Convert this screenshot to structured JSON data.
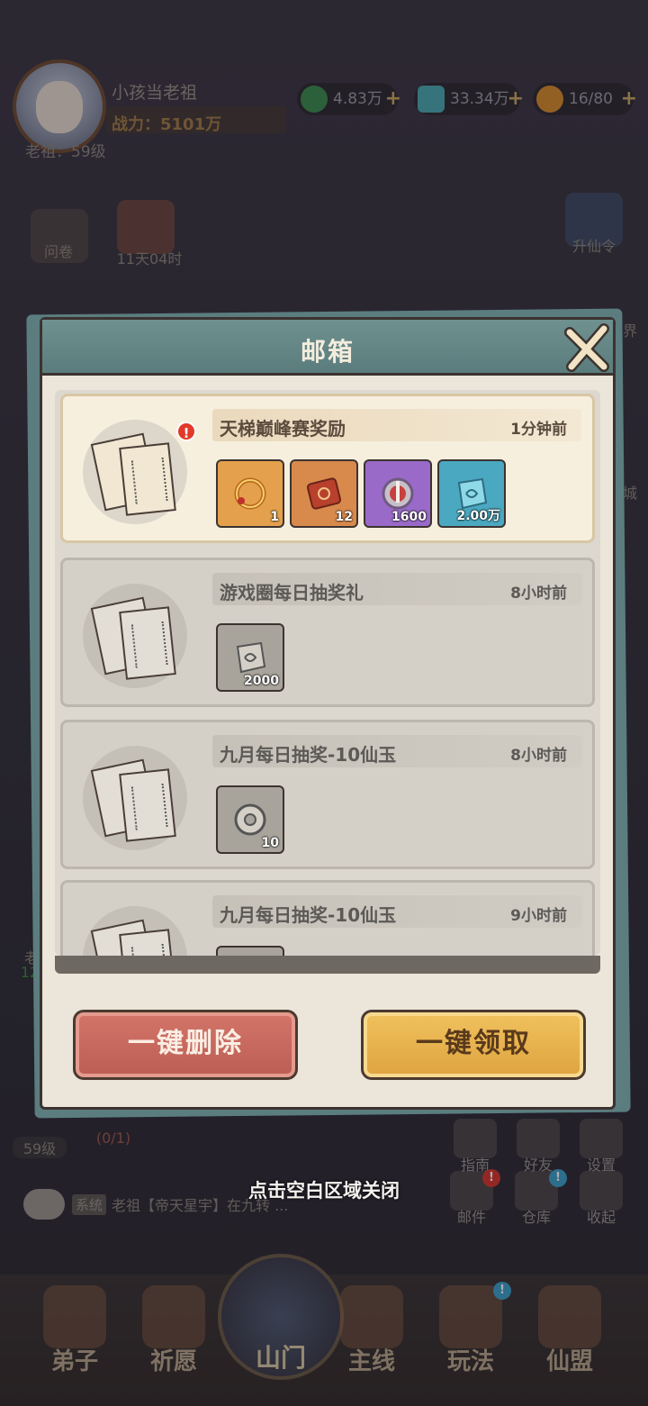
{
  "player": {
    "name": "小孩当老祖",
    "power": "战力：5101万",
    "level": "老祖：59级"
  },
  "resources": [
    {
      "icon": "jade-icon",
      "value": "4.83万",
      "color": "#3a8a4c"
    },
    {
      "icon": "spirit-stone-icon",
      "value": "33.34万",
      "color": "#4aa8b0"
    },
    {
      "icon": "stamina-icon",
      "value": "16/80",
      "color": "#d88a2a"
    }
  ],
  "side_left": {
    "survey": "问卷",
    "event_timer": "11天04时"
  },
  "side_right": {
    "ascend_pass": "升仙令",
    "realm_partial": "界",
    "city_partial": "城"
  },
  "background_partial": {
    "level_left": "59级",
    "progress": "(0/1)",
    "left_tag": "老",
    "left_num": "12"
  },
  "modal": {
    "title": "邮箱",
    "mails": [
      {
        "title": "天梯巅峰赛奖励",
        "time": "1分钟前",
        "read": false,
        "items": [
          {
            "icon": "flame-ring-icon",
            "qty": "1"
          },
          {
            "icon": "red-scroll-icon",
            "qty": "12"
          },
          {
            "icon": "sword-emblem-icon",
            "qty": "1600"
          },
          {
            "icon": "spirit-crystal-icon",
            "qty": "2.00万"
          }
        ]
      },
      {
        "title": "游戏圈每日抽奖礼",
        "time": "8小时前",
        "read": true,
        "items": [
          {
            "icon": "spirit-crystal-icon",
            "qty": "2000"
          }
        ]
      },
      {
        "title": "九月每日抽奖-10仙玉",
        "time": "8小时前",
        "read": true,
        "items": [
          {
            "icon": "immortal-jade-icon",
            "qty": "10"
          }
        ]
      },
      {
        "title": "九月每日抽奖-10仙玉",
        "time": "9小时前",
        "read": true,
        "items": [
          {
            "icon": "immortal-jade-icon",
            "qty": ""
          }
        ]
      }
    ],
    "delete_all": "一键删除",
    "claim_all": "一键领取"
  },
  "close_hint": "点击空白区域关闭",
  "chat": {
    "channel": "系统",
    "message": "老祖【帝天星宇】在九转 ..."
  },
  "bottom_right": {
    "guide": "指南",
    "friends": "好友",
    "settings": "设置",
    "mail": "邮件",
    "warehouse": "仓库",
    "collapse": "收起"
  },
  "bottom_nav": [
    {
      "label": "弟子"
    },
    {
      "label": "祈愿"
    },
    {
      "label": "山门"
    },
    {
      "label": "主线"
    },
    {
      "label": "玩法"
    },
    {
      "label": "仙盟"
    }
  ]
}
